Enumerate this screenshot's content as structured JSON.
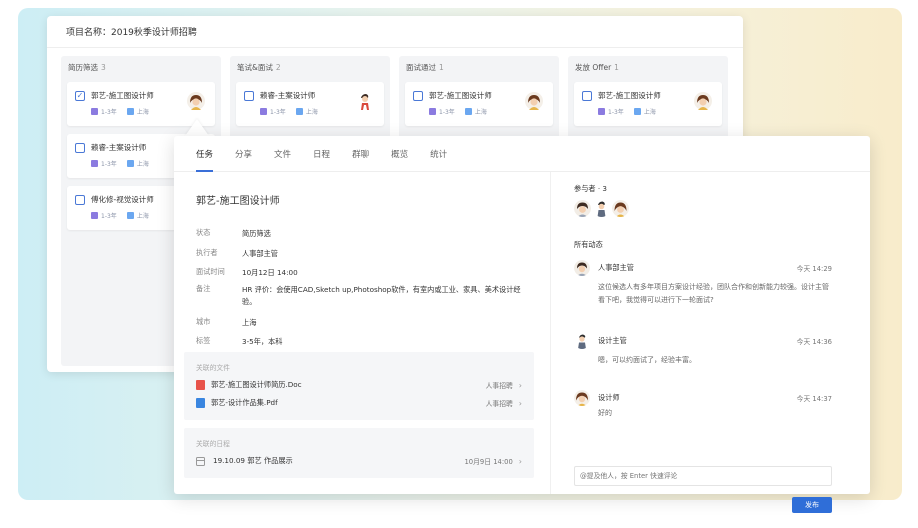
{
  "board": {
    "project_title": "项目名称：2019秋季设计师招聘",
    "columns": [
      {
        "title": "简历筛选",
        "count": "3",
        "cards": [
          {
            "name": "郭艺-施工图设计师",
            "checked": true,
            "exp": "1-3年",
            "city": "上海",
            "avatar": "female"
          },
          {
            "name": "赖睿-主案设计师",
            "checked": false,
            "exp": "1-3年",
            "city": "上海",
            "avatar": "none"
          },
          {
            "name": "傅化修-视觉设计师",
            "checked": false,
            "exp": "1-3年",
            "city": "上海",
            "avatar": "none"
          }
        ]
      },
      {
        "title": "笔试&面试",
        "count": "2",
        "cards": [
          {
            "name": "赖睿-主案设计师",
            "checked": false,
            "exp": "1-3年",
            "city": "上海",
            "avatar": "male-red"
          }
        ]
      },
      {
        "title": "面试通过",
        "count": "1",
        "cards": [
          {
            "name": "郭艺-施工图设计师",
            "checked": false,
            "exp": "1-3年",
            "city": "上海",
            "avatar": "female"
          }
        ]
      },
      {
        "title": "发放 Offer",
        "count": "1",
        "cards": [
          {
            "name": "郭艺-施工图设计师",
            "checked": false,
            "exp": "1-3年",
            "city": "上海",
            "avatar": "female"
          }
        ]
      }
    ]
  },
  "detail": {
    "tabs": [
      "任务",
      "分享",
      "文件",
      "日程",
      "群聊",
      "概览",
      "统计"
    ],
    "active_tab": "任务",
    "title": "郭艺-施工图设计师",
    "fields": [
      {
        "key": "状态",
        "value": "简历筛选"
      },
      {
        "key": "执行者",
        "value": "人事部主管"
      },
      {
        "key": "面试时间",
        "value": "10月12日 14:00"
      },
      {
        "key": "备注",
        "value": "HR 评价：会使用CAD,Sketch up,Photoshop软件，有室内或工业、家具、美术设计经验。"
      },
      {
        "key": "城市",
        "value": "上海"
      },
      {
        "key": "标签",
        "value": "3-5年，本科"
      }
    ],
    "files": {
      "title": "关联的文件",
      "items": [
        {
          "name": "郭艺-施工图设计师简历.Doc",
          "dest": "人事招聘",
          "color": "#e8534a"
        },
        {
          "name": "郭艺-设计作品集.Pdf",
          "dest": "人事招聘",
          "color": "#3a86e0"
        }
      ]
    },
    "schedule": {
      "title": "关联的日程",
      "items": [
        {
          "name": "19.10.09 郭艺 作品展示",
          "time": "10月9日 14:00"
        }
      ]
    },
    "participants": {
      "label": "参与者 · 3"
    },
    "activity": {
      "label": "所有动态",
      "items": [
        {
          "user": "人事部主管",
          "time": "今天 14:29",
          "text": "这位候选人有多年项目方案设计经验，团队合作和创新能力较强。设计主管看下吧，我觉得可以进行下一轮面试?"
        },
        {
          "user": "设计主管",
          "time": "今天 14:36",
          "text": "嗯，可以约面试了，经验丰富。"
        },
        {
          "user": "设计师",
          "time": "今天 14:37",
          "text": "好的"
        }
      ]
    },
    "comment_placeholder": "@提及他人，按 Enter 快速评论",
    "publish_label": "发布"
  },
  "colors": {
    "accent": "#2f6ed8",
    "checkbox": "#4a78d6",
    "tag_exp": "#8b7be0",
    "tag_city": "#6ba7f0"
  }
}
